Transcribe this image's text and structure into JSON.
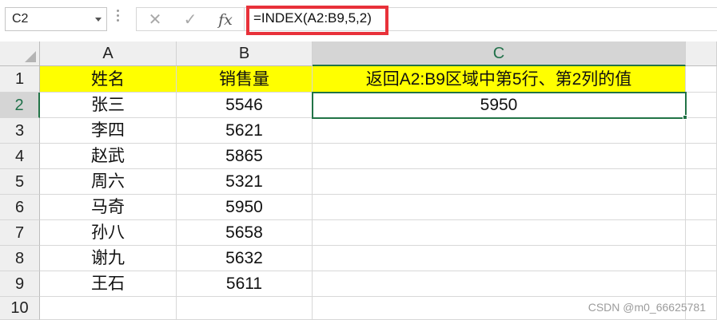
{
  "formula_bar": {
    "name_box": "C2",
    "cancel_icon": "✕",
    "enter_icon": "✓",
    "fx_label": "fx",
    "formula": "=INDEX(A2:B9,5,2)"
  },
  "columns": [
    "A",
    "B",
    "C"
  ],
  "active_column": "C",
  "active_row": "2",
  "rows": [
    {
      "num": "1",
      "a": "姓名",
      "b": "销售量",
      "c": "返回A2:B9区域中第5行、第2列的值"
    },
    {
      "num": "2",
      "a": "张三",
      "b": "5546",
      "c": "5950"
    },
    {
      "num": "3",
      "a": "李四",
      "b": "5621",
      "c": ""
    },
    {
      "num": "4",
      "a": "赵武",
      "b": "5865",
      "c": ""
    },
    {
      "num": "5",
      "a": "周六",
      "b": "5321",
      "c": ""
    },
    {
      "num": "6",
      "a": "马奇",
      "b": "5950",
      "c": ""
    },
    {
      "num": "7",
      "a": "孙八",
      "b": "5658",
      "c": ""
    },
    {
      "num": "8",
      "a": "谢九",
      "b": "5632",
      "c": ""
    },
    {
      "num": "9",
      "a": "王石",
      "b": "5611",
      "c": ""
    },
    {
      "num": "10",
      "a": "",
      "b": "",
      "c": ""
    }
  ],
  "colors": {
    "header_fill": "#ffff00",
    "selection": "#217346",
    "formula_highlight": "#e8313a"
  },
  "watermark": "CSDN @m0_66625781"
}
